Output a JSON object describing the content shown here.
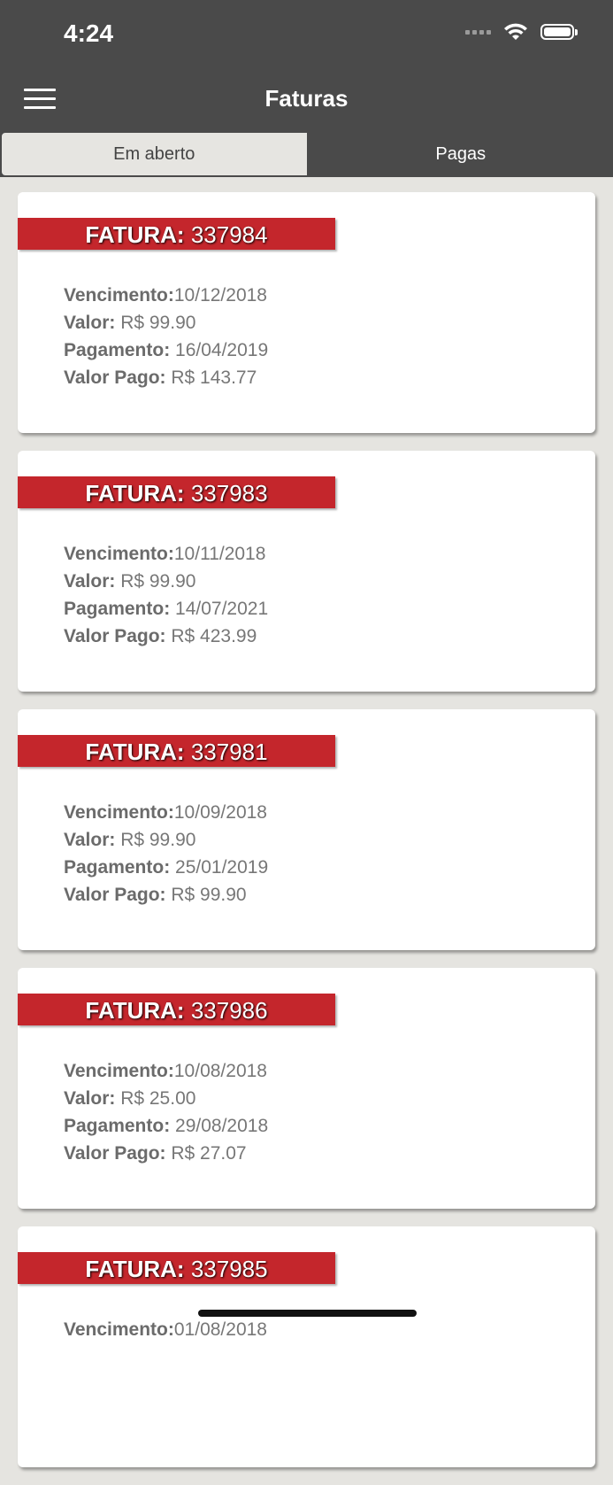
{
  "status_bar": {
    "time": "4:24"
  },
  "header": {
    "title": "Faturas"
  },
  "tabs": [
    {
      "label": "Em aberto",
      "active": true
    },
    {
      "label": "Pagas",
      "active": false
    }
  ],
  "labels": {
    "fatura": "FATURA:",
    "vencimento": "Vencimento:",
    "valor": "Valor:",
    "pagamento": "Pagamento:",
    "valor_pago": "Valor Pago:"
  },
  "invoices": [
    {
      "number": "337984",
      "vencimento": "10/12/2018",
      "valor": "R$ 99.90",
      "pagamento": "16/04/2019",
      "valor_pago": "R$ 143.77"
    },
    {
      "number": "337983",
      "vencimento": "10/11/2018",
      "valor": "R$ 99.90",
      "pagamento": "14/07/2021",
      "valor_pago": "R$ 423.99"
    },
    {
      "number": "337981",
      "vencimento": "10/09/2018",
      "valor": "R$ 99.90",
      "pagamento": "25/01/2019",
      "valor_pago": "R$ 99.90"
    },
    {
      "number": "337986",
      "vencimento": "10/08/2018",
      "valor": "R$ 25.00",
      "pagamento": "29/08/2018",
      "valor_pago": "R$ 27.07"
    },
    {
      "number": "337985",
      "vencimento": "01/08/2018",
      "valor": "",
      "pagamento": "",
      "valor_pago": ""
    }
  ],
  "colors": {
    "bar": "#4a4a4a",
    "ribbon": "#c4262c",
    "background": "#e5e4e0"
  }
}
